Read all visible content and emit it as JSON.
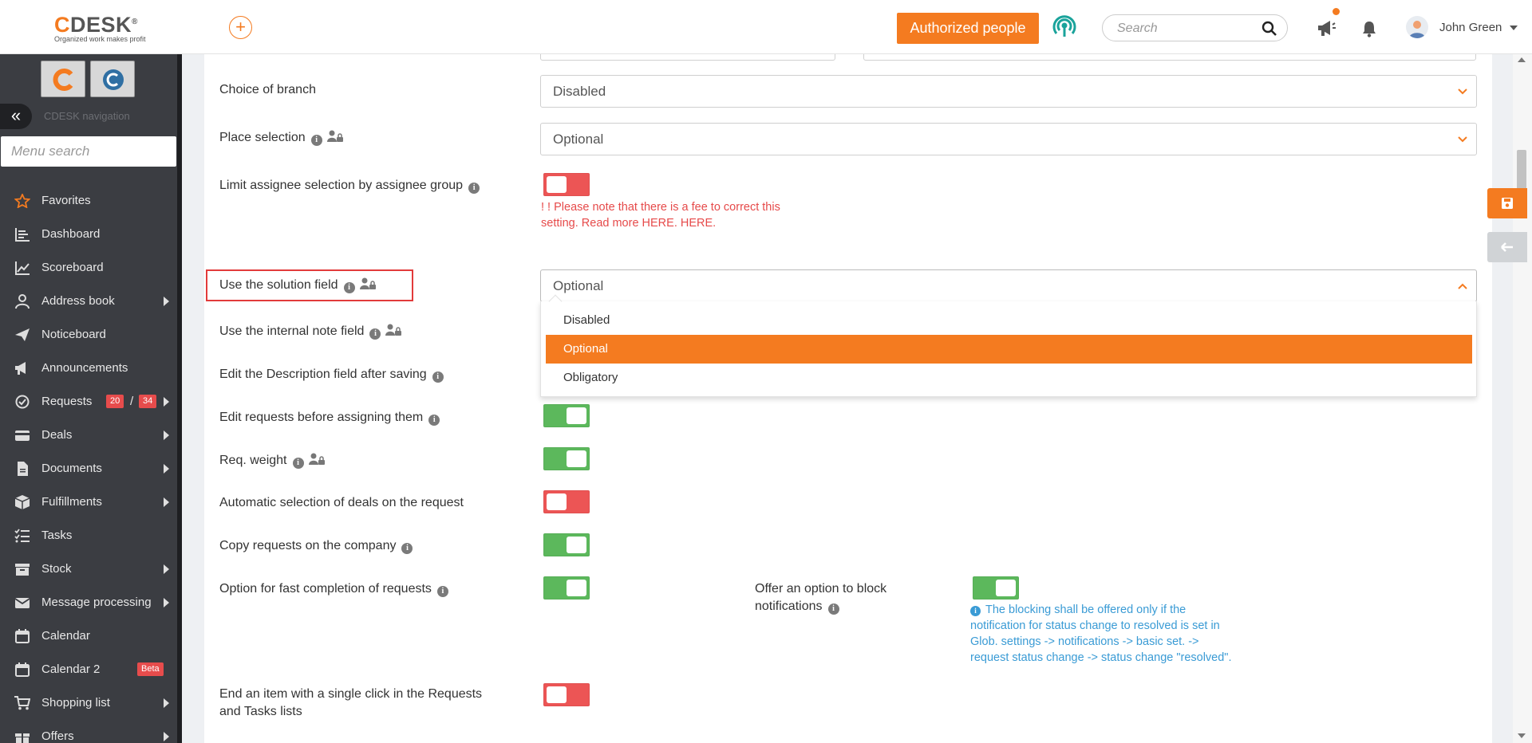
{
  "header": {
    "logo_text": "CDESK",
    "logo_first": "C",
    "logo_rest": "DESK",
    "logo_mark": "®",
    "logo_tagline": "Organized work makes profit",
    "authorized_label": "Authorized people",
    "search_placeholder": "Search",
    "user_name": "John Green",
    "accent_color": "#f47b20"
  },
  "sidebar": {
    "nav_caption": "CDESK navigation",
    "menu_search_placeholder": "Menu search",
    "items": [
      {
        "label": "Favorites",
        "icon": "star-icon",
        "arrow": false
      },
      {
        "label": "Dashboard",
        "icon": "dashboard-icon",
        "arrow": false
      },
      {
        "label": "Scoreboard",
        "icon": "chart-line-icon",
        "arrow": false
      },
      {
        "label": "Address book",
        "icon": "user-icon",
        "arrow": true
      },
      {
        "label": "Noticeboard",
        "icon": "paper-plane-icon",
        "arrow": false
      },
      {
        "label": "Announcements",
        "icon": "megaphone-icon",
        "arrow": false
      },
      {
        "label": "Requests",
        "icon": "check-circle-icon",
        "arrow": true
      },
      {
        "label": "Deals",
        "icon": "card-icon",
        "arrow": true
      },
      {
        "label": "Documents",
        "icon": "document-icon",
        "arrow": true
      },
      {
        "label": "Fulfillments",
        "icon": "box-icon",
        "arrow": true
      },
      {
        "label": "Tasks",
        "icon": "tasks-icon",
        "arrow": false
      },
      {
        "label": "Stock",
        "icon": "stock-icon",
        "arrow": true
      },
      {
        "label": "Message processing",
        "icon": "envelope-icon",
        "arrow": true
      },
      {
        "label": "Calendar",
        "icon": "calendar-icon",
        "arrow": false
      },
      {
        "label": "Calendar 2",
        "icon": "calendar-icon",
        "arrow": false
      },
      {
        "label": "Shopping list",
        "icon": "cart-icon",
        "arrow": true
      },
      {
        "label": "Offers",
        "icon": "gift-icon",
        "arrow": true
      }
    ],
    "requests_badge_1": "20",
    "requests_badge_sep": "/",
    "requests_badge_2": "34",
    "calendar2_badge": "Beta"
  },
  "settings": {
    "choice_of_branch": {
      "label": "Choice of branch",
      "value": "Disabled"
    },
    "place_selection": {
      "label": "Place selection",
      "value": "Optional"
    },
    "limit_assignee": {
      "label": "Limit assignee selection by assignee group",
      "on": false
    },
    "limit_warning_line1": "! ! Please note that there is a fee to correct this",
    "limit_warning_line2": "setting. Read more HERE. HERE.",
    "solution_field": {
      "label": "Use the solution field",
      "value": "Optional",
      "options": [
        "Disabled",
        "Optional",
        "Obligatory"
      ],
      "selected": "Optional"
    },
    "internal_note": {
      "label": "Use the internal note field"
    },
    "edit_description": {
      "label": "Edit the Description field after saving"
    },
    "edit_before_assign": {
      "label": "Edit requests before assigning them",
      "on": true
    },
    "req_weight": {
      "label": "Req. weight",
      "on": true
    },
    "auto_deals": {
      "label": "Automatic selection of deals on the request",
      "on": false
    },
    "copy_requests": {
      "label": "Copy requests on the company",
      "on": true
    },
    "fast_completion": {
      "label": "Option for fast completion of requests",
      "on": true
    },
    "block_notifications": {
      "label_line1": "Offer an option to block",
      "label_line2": "notifications",
      "on": true
    },
    "block_note_line1": "The blocking shall be offered only if the",
    "block_note_line2": "notification for status change to resolved is set in",
    "block_note_line3": "Glob. settings -> notifications -> basic set. ->",
    "block_note_line4": "request status change -> status change \"resolved\".",
    "end_item": {
      "label_line1": "End an item with a single click in the Requests",
      "label_line2": "and Tasks lists",
      "on": false
    }
  }
}
